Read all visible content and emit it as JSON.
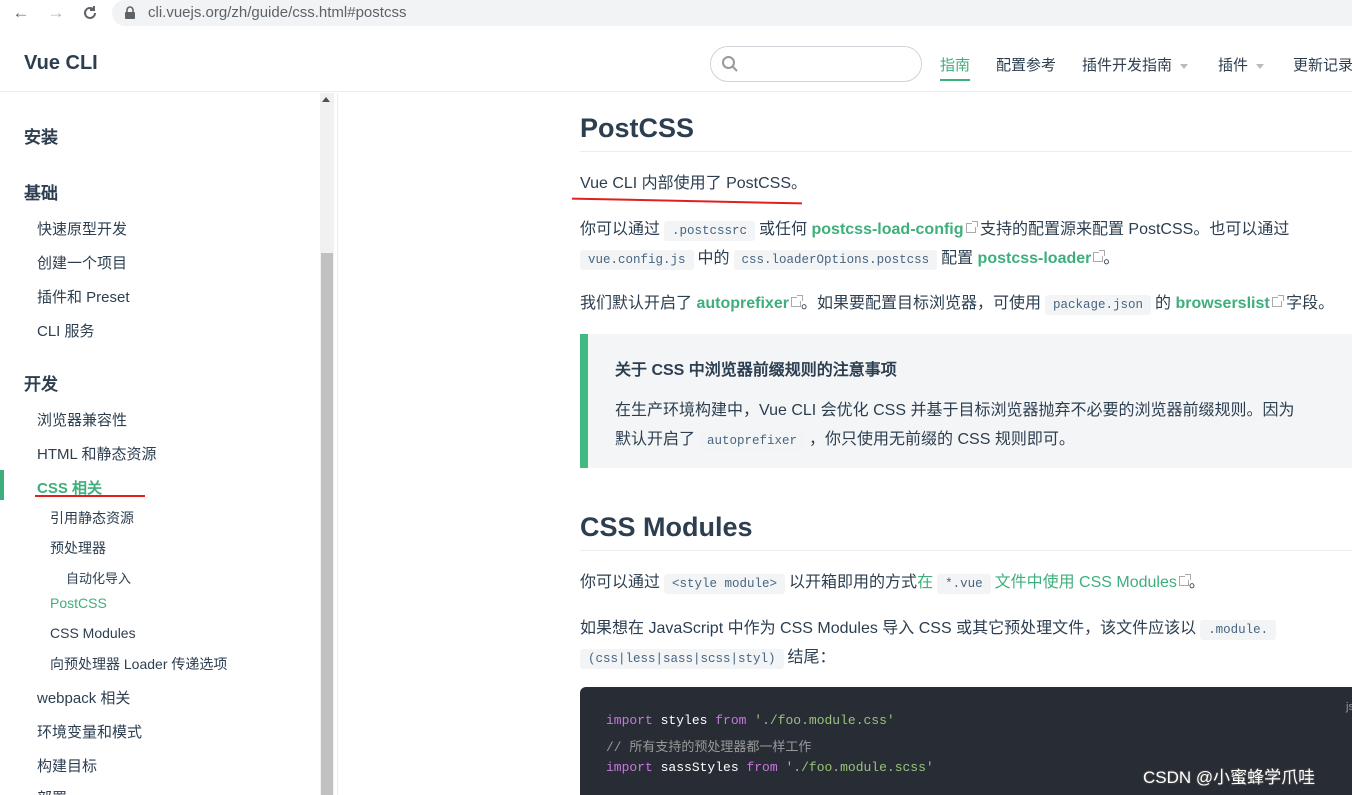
{
  "browser": {
    "url": "cli.vuejs.org/zh/guide/css.html#postcss"
  },
  "navbar": {
    "site_title": "Vue CLI",
    "search_placeholder": "",
    "links": {
      "guide": "指南",
      "config": "配置参考",
      "plugin_dev": "插件开发指南",
      "plugins": "插件",
      "changelog": "更新记录"
    }
  },
  "sidebar": {
    "install": "安装",
    "basics": "基础",
    "basics_items": {
      "prototyping": "快速原型开发",
      "creating": "创建一个项目",
      "plugins_preset": "插件和 Preset",
      "cli_service": "CLI 服务"
    },
    "development": "开发",
    "dev_items": {
      "browser_compat": "浏览器兼容性",
      "html_static": "HTML 和静态资源",
      "css": "CSS 相关",
      "css_sub": {
        "static_assets": "引用静态资源",
        "preprocessors": "预处理器",
        "auto_import": "自动化导入",
        "postcss": "PostCSS",
        "css_modules": "CSS Modules",
        "loader_options": "向预处理器 Loader 传递选项"
      },
      "webpack": "webpack 相关",
      "env_modes": "环境变量和模式",
      "build_targets": "构建目标",
      "deploy": "部署"
    }
  },
  "content": {
    "postcss_title": "PostCSS",
    "postcss_intro": "Vue CLI 内部使用了 PostCSS。",
    "p2": {
      "t1": "你可以通过",
      "c1": ".postcssrc",
      "t2": "或任何",
      "l1": "postcss-load-config",
      "t3": "支持的配置源来配置 PostCSS。也可以通过",
      "c2": "vue.config.js",
      "t4": "中的",
      "c3": "css.loaderOptions.postcss",
      "t5": "配置",
      "l2": "postcss-loader",
      "t6": "。"
    },
    "p3": {
      "t1": "我们默认开启了",
      "l1": "autoprefixer",
      "t2": "。如果要配置目标浏览器，可使用",
      "c1": "package.json",
      "t3": "的",
      "l2": "browserslist",
      "t4": "字段。"
    },
    "tip": {
      "title": "关于 CSS 中浏览器前缀规则的注意事项",
      "line1": "在生产环境构建中，Vue CLI 会优化 CSS 并基于目标浏览器抛弃不必要的浏览器前缀规则。因为",
      "line2_t1": "默认开启了",
      "line2_c1": "autoprefixer",
      "line2_t2": "，你只使用无前缀的 CSS 规则即可。"
    },
    "modules_title": "CSS Modules",
    "p4": {
      "t1": "你可以通过",
      "c1": "<style module>",
      "t2": "以开箱即用的方式",
      "t3": "在",
      "c2": "*.vue",
      "l1": "文件中使用 CSS Modules",
      "t4": "。"
    },
    "p5": {
      "t1": "如果想在 JavaScript 中作为 CSS Modules 导入 CSS 或其它预处理文件，该文件应该以",
      "c1": ".module.",
      "c2": "(css|less|sass|scss|styl)",
      "t2": "结尾："
    },
    "code": {
      "lang": "js",
      "l1_kw": "import",
      "l1_id": "styles",
      "l1_from": "from",
      "l1_str": "'./foo.module.css'",
      "l2_comment": "// 所有支持的预处理器都一样工作",
      "l3_kw": "import",
      "l3_id": "sassStyles",
      "l3_from": "from",
      "l3_str": "'./foo.module.scss'"
    }
  },
  "watermark": "CSDN @小蜜蜂学爪哇",
  "colors": {
    "accent": "#3eaf7c",
    "annotation_red": "#e02020",
    "code_bg": "#282c34"
  }
}
